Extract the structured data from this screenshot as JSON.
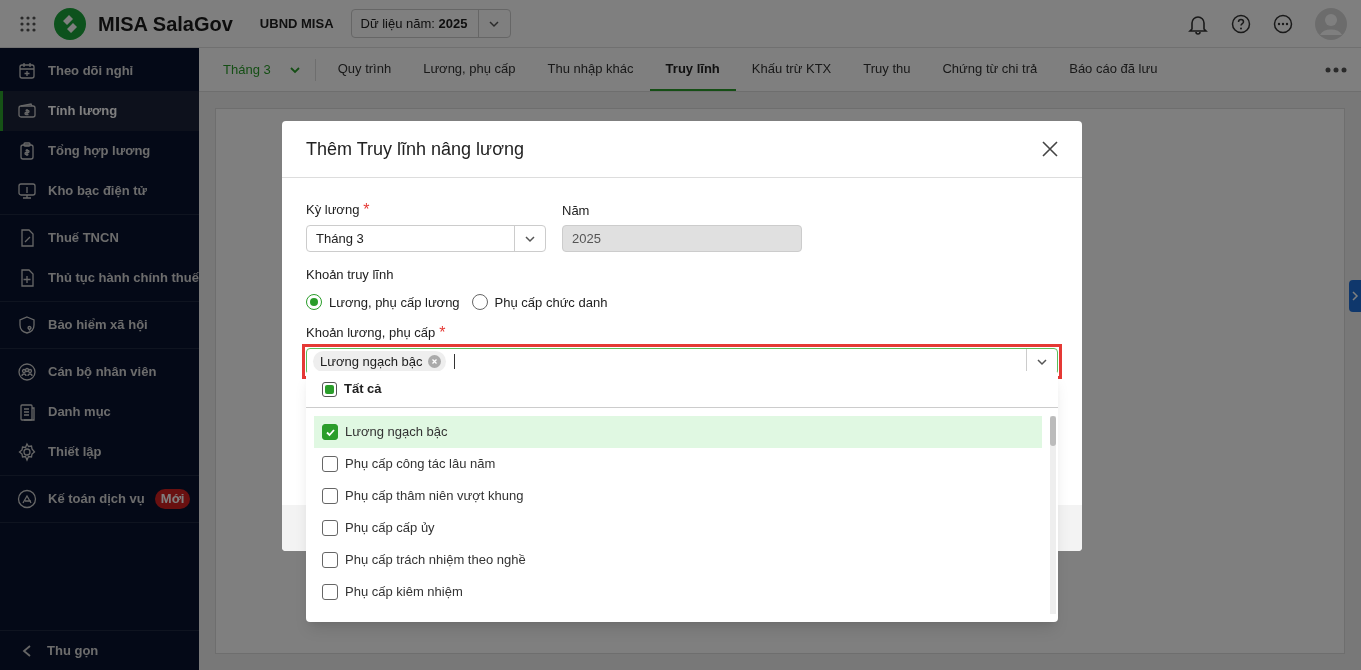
{
  "header": {
    "app_name": "MISA SalaGov",
    "unit": "UBND MISA",
    "year_selector": "Dữ liệu năm: **2025**"
  },
  "sidebar": {
    "groups": [
      [
        {
          "label": "Theo dõi nghỉ",
          "selected": false
        },
        {
          "label": "Tính lương",
          "selected": true
        },
        {
          "label": "Tổng hợp lương",
          "selected": false
        },
        {
          "label": "Kho bạc điện tử",
          "selected": false
        }
      ],
      [
        {
          "label": "Thuế TNCN",
          "selected": false
        },
        {
          "label": "Thủ tục hành chính thuế",
          "selected": false
        }
      ],
      [
        {
          "label": "Bảo hiểm xã hội",
          "selected": false
        }
      ],
      [
        {
          "label": "Cán bộ nhân viên",
          "selected": false
        },
        {
          "label": "Danh mục",
          "selected": false
        },
        {
          "label": "Thiết lập",
          "selected": false
        }
      ],
      [
        {
          "label": "Kế toán dịch vụ",
          "selected": false,
          "badge": "Mới"
        }
      ]
    ],
    "collapse": "Thu gọn"
  },
  "period_selector": "Tháng 3",
  "tabs": [
    {
      "label": "Quy trình",
      "selected": false
    },
    {
      "label": "Lương, phụ cấp",
      "selected": false
    },
    {
      "label": "Thu nhập khác",
      "selected": false
    },
    {
      "label": "Truy lĩnh",
      "selected": true
    },
    {
      "label": "Khấu trừ KTX",
      "selected": false
    },
    {
      "label": "Truy thu",
      "selected": false
    },
    {
      "label": "Chứng từ chi trả",
      "selected": false
    },
    {
      "label": "Báo cáo đã lưu",
      "selected": false
    }
  ],
  "dialog": {
    "title": "Thêm Truy lĩnh nâng lương",
    "period": {
      "label": "Kỳ lương",
      "required_mark": "*",
      "value": "Tháng 3"
    },
    "year": {
      "label": "Năm",
      "value": "2025",
      "disabled": true
    },
    "type": {
      "label": "Khoản truy lĩnh",
      "options": [
        {
          "label": "Lương, phụ cấp lương",
          "selected": true
        },
        {
          "label": "Phụ cấp chức danh",
          "selected": false
        }
      ]
    },
    "items": {
      "label": "Khoản lương, phụ cấp",
      "required_mark": "*",
      "tags": [
        "Lương ngạch bậc"
      ]
    },
    "dropdown": {
      "select_all": {
        "label": "Tất cả",
        "indeterminate": true
      },
      "options": [
        {
          "label": "Lương ngạch bậc",
          "checked": true
        },
        {
          "label": "Phụ cấp công tác lâu năm",
          "checked": false
        },
        {
          "label": "Phụ cấp thâm niên vượt khung",
          "checked": false
        },
        {
          "label": "Phụ cấp cấp ủy",
          "checked": false
        },
        {
          "label": "Phụ cấp trách nhiệm theo nghề",
          "checked": false
        },
        {
          "label": "Phụ cấp kiêm nhiệm",
          "checked": false
        }
      ]
    }
  }
}
